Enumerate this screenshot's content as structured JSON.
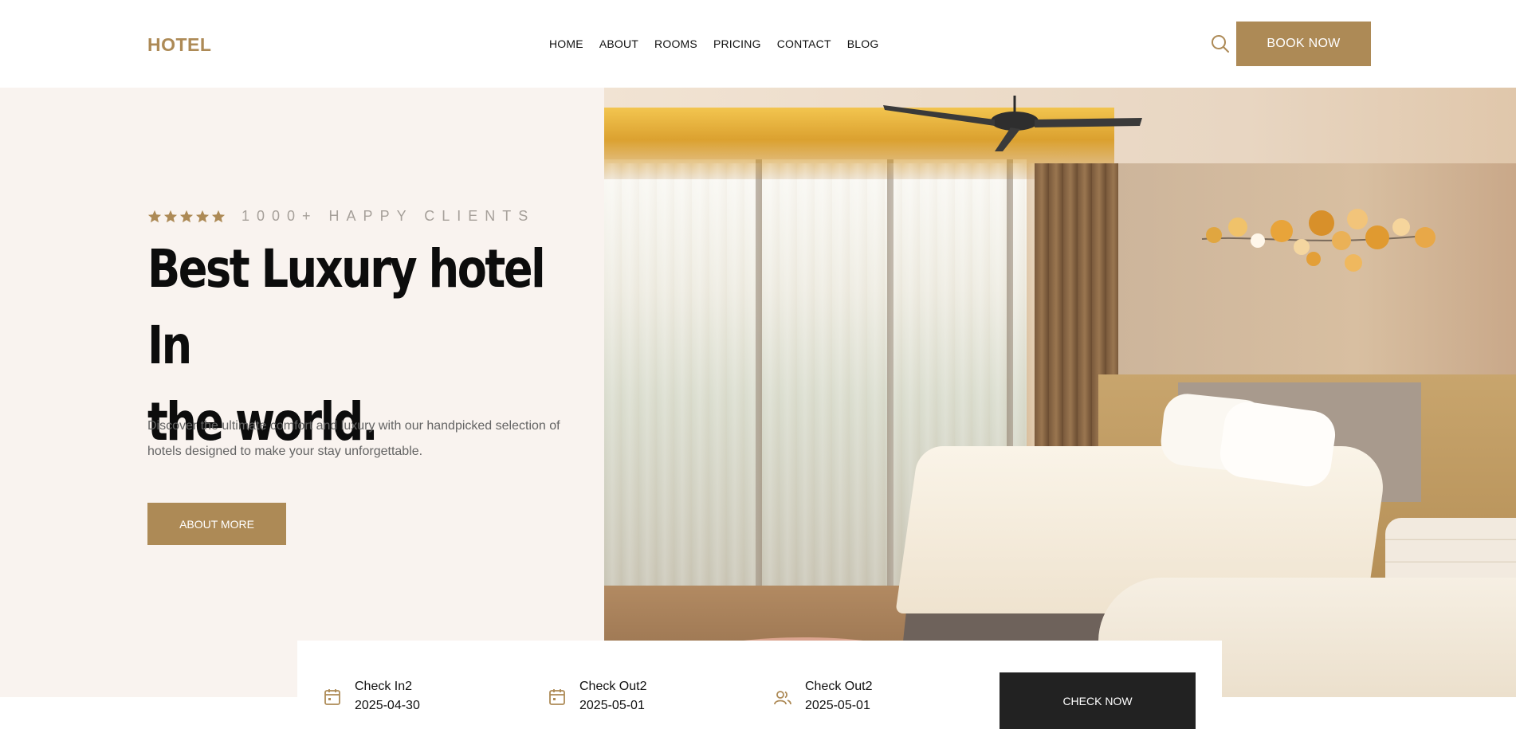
{
  "header": {
    "logo": "HOTEL",
    "nav": [
      "HOME",
      "ABOUT",
      "ROOMS",
      "PRICING",
      "CONTACT",
      "BLOG"
    ],
    "search_icon": "search-icon",
    "book_label": "BOOK NOW"
  },
  "hero": {
    "rating_stars": 5,
    "clients_text": "1000+ HAPPY CLIENTS",
    "title_line1": "Best Luxury hotel In",
    "title_line2": "the world.",
    "description": "Discover the ultimate comfort and luxury with our handpicked selection of hotels designed to make your stay unforgettable.",
    "about_label": "ABOUT MORE"
  },
  "booking": {
    "check_in": {
      "label": "Check In2",
      "value": "2025-04-30",
      "icon": "calendar-icon"
    },
    "check_out": {
      "label": "Check Out2",
      "value": "2025-05-01",
      "icon": "calendar-icon"
    },
    "guests": {
      "label": "Check Out2",
      "value": "2025-05-01",
      "icon": "users-icon"
    },
    "check_label": "CHECK NOW"
  },
  "colors": {
    "accent": "#ad8a56",
    "hero_bg": "#f9f3ef",
    "dark_button": "#222222",
    "muted_text": "#646464"
  }
}
